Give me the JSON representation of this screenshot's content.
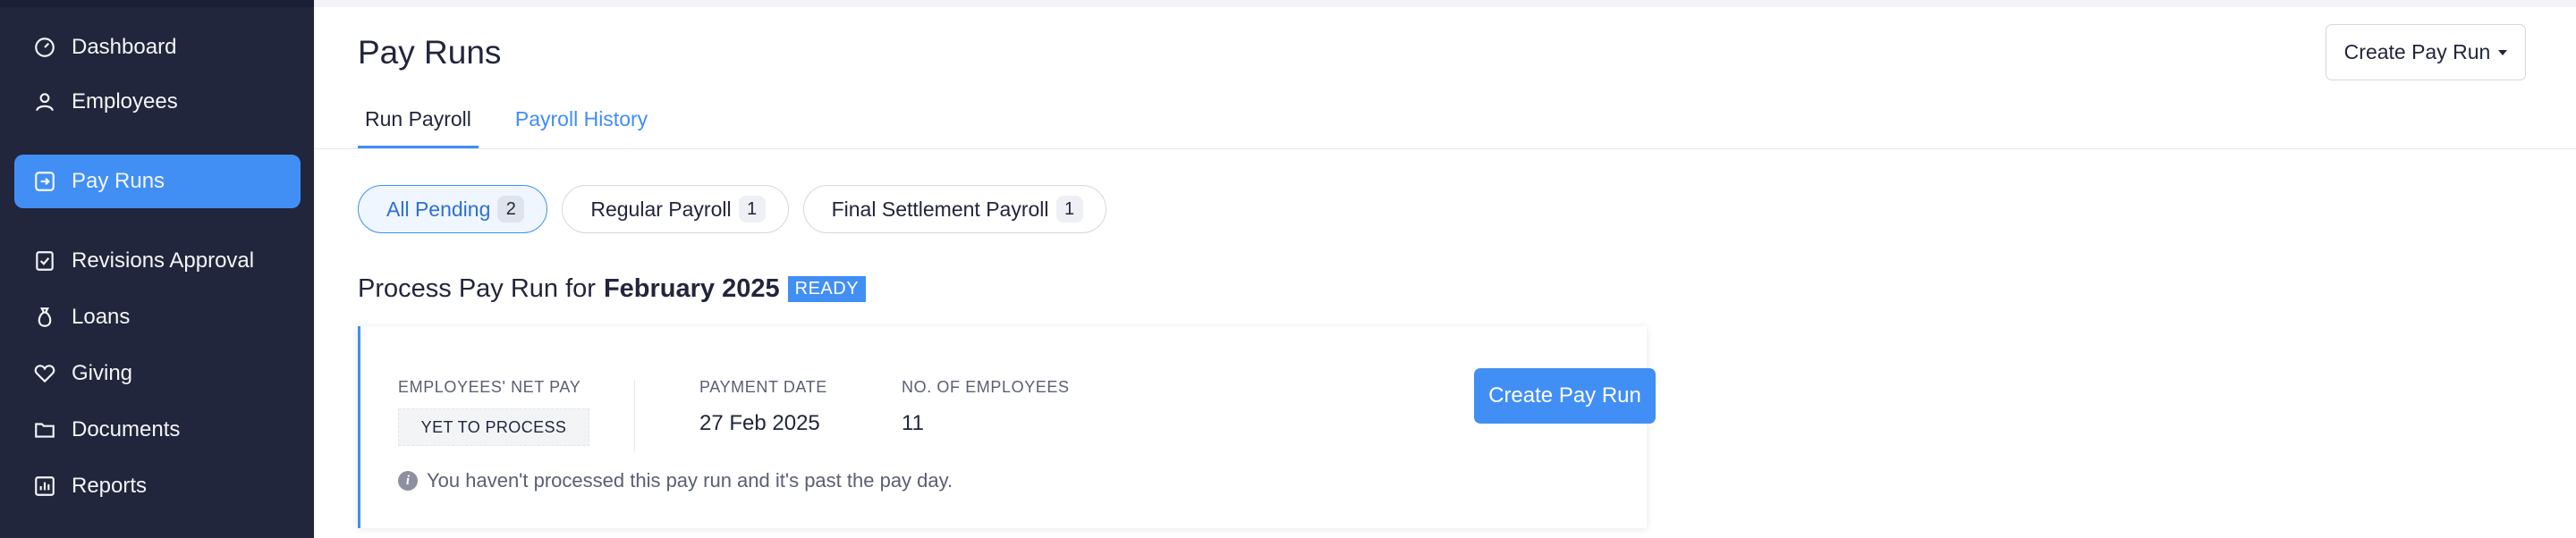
{
  "sidebar": {
    "items": [
      {
        "label": "Dashboard",
        "icon": "gauge-icon"
      },
      {
        "label": "Employees",
        "icon": "user-icon"
      },
      {
        "label": "Pay Runs",
        "icon": "pay-runs-icon",
        "active": true
      },
      {
        "label": "Revisions Approval",
        "icon": "check-square-icon"
      },
      {
        "label": "Loans",
        "icon": "money-bag-icon"
      },
      {
        "label": "Giving",
        "icon": "heart-icon"
      },
      {
        "label": "Documents",
        "icon": "folder-icon"
      },
      {
        "label": "Reports",
        "icon": "bar-chart-icon"
      }
    ]
  },
  "header": {
    "title": "Pay Runs",
    "create_button": "Create Pay Run"
  },
  "tabs": [
    {
      "label": "Run Payroll",
      "active": true
    },
    {
      "label": "Payroll History",
      "active": false
    }
  ],
  "filters": [
    {
      "label": "All Pending",
      "count": "2",
      "active": true
    },
    {
      "label": "Regular Payroll",
      "count": "1",
      "active": false
    },
    {
      "label": "Final Settlement Payroll",
      "count": "1",
      "active": false
    }
  ],
  "pay_run": {
    "title_prefix": "Process Pay Run for",
    "period": "February 2025",
    "status": "READY",
    "net_pay_label": "EMPLOYEES' NET PAY",
    "net_pay_value": "YET TO PROCESS",
    "payment_date_label": "PAYMENT DATE",
    "payment_date_value": "27 Feb 2025",
    "employees_label": "NO. OF EMPLOYEES",
    "employees_value": "11",
    "action_button": "Create Pay Run",
    "note": "You haven't processed this pay run and it's past the pay day."
  },
  "colors": {
    "sidebar_bg": "#21263c",
    "accent": "#418ff5",
    "link": "#408dfb"
  }
}
